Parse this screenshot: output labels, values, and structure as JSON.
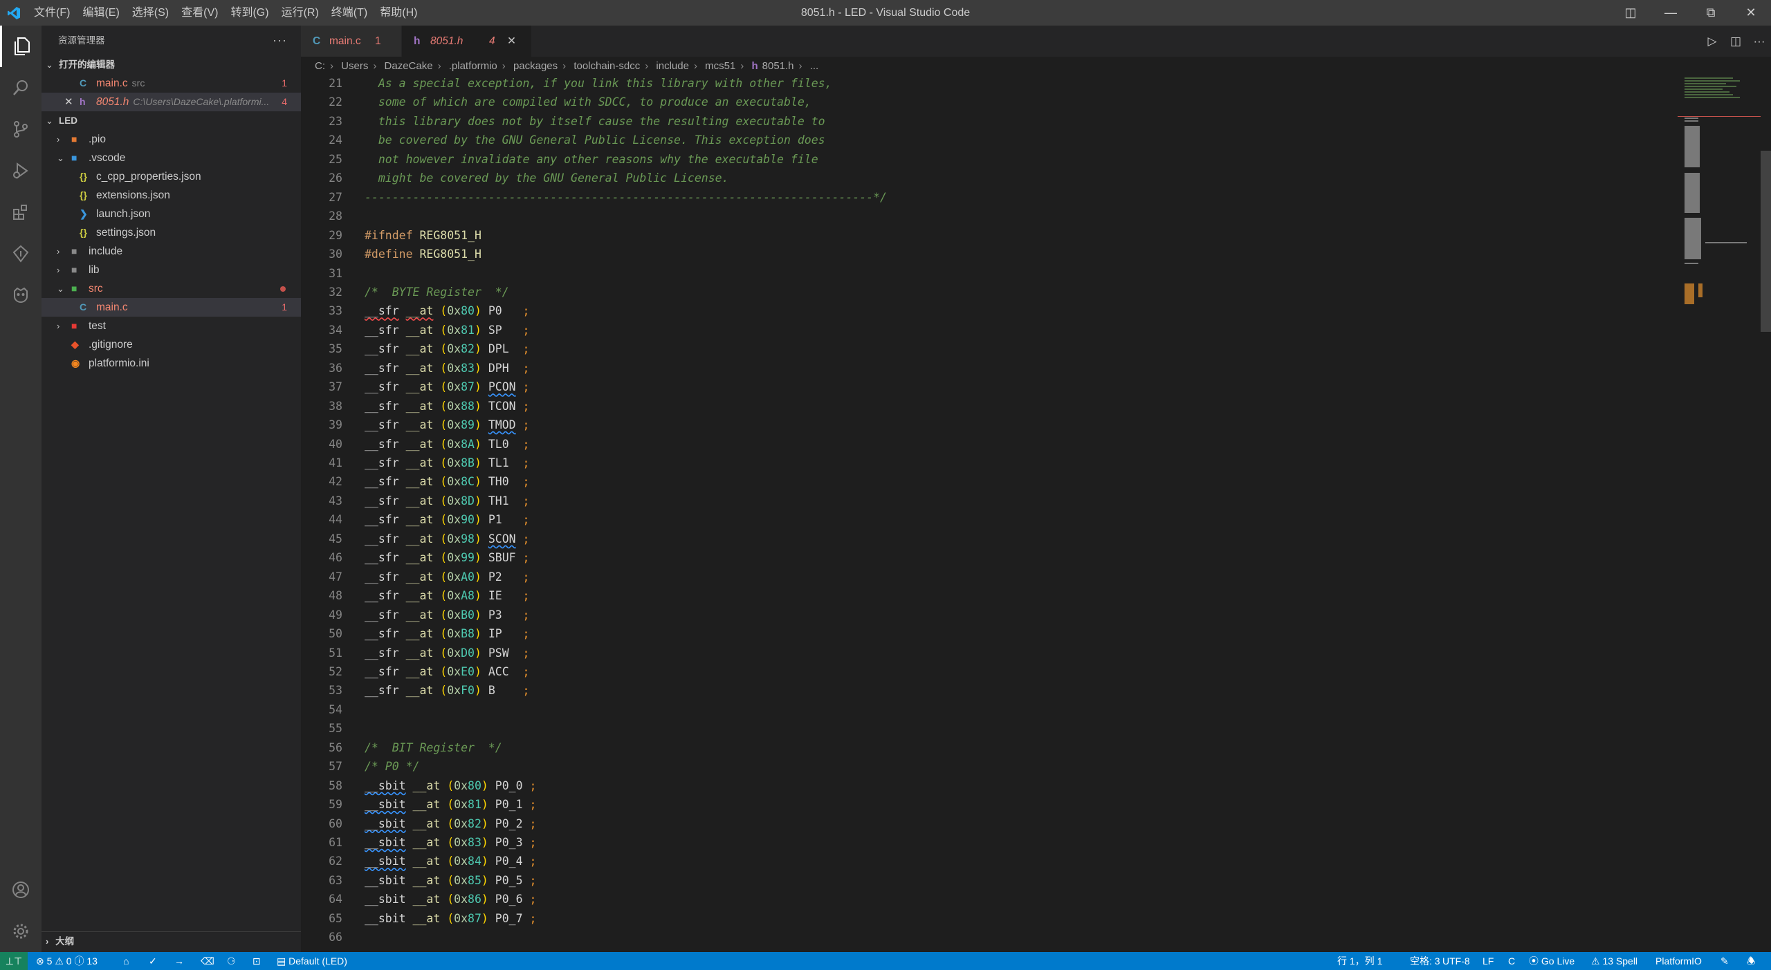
{
  "titlebar": {
    "menu": [
      "文件(F)",
      "编辑(E)",
      "选择(S)",
      "查看(V)",
      "转到(G)",
      "运行(R)",
      "终端(T)",
      "帮助(H)"
    ],
    "title": "8051.h - LED - Visual Studio Code"
  },
  "sidebar": {
    "header": "资源管理器",
    "open_editors": {
      "title": "打开的编辑器",
      "items": [
        {
          "name": "main.c",
          "desc": "src",
          "badge": "1"
        },
        {
          "name": "8051.h",
          "desc": "C:\\Users\\DazeCake\\.platformi...",
          "badge": "4"
        }
      ]
    },
    "project": {
      "title": "LED",
      "items": [
        {
          "name": ".pio"
        },
        {
          "name": ".vscode"
        },
        {
          "name": "c_cpp_properties.json"
        },
        {
          "name": "extensions.json"
        },
        {
          "name": "launch.json"
        },
        {
          "name": "settings.json"
        },
        {
          "name": "include"
        },
        {
          "name": "lib"
        },
        {
          "name": "src"
        },
        {
          "name": "main.c",
          "badge": "1"
        },
        {
          "name": "test"
        },
        {
          "name": ".gitignore"
        },
        {
          "name": "platformio.ini"
        }
      ]
    },
    "outline_title": "大纲"
  },
  "tabs": [
    {
      "label": "main.c",
      "badge": "1"
    },
    {
      "label": "8051.h",
      "badge": "4"
    }
  ],
  "breadcrumb": [
    "C:",
    "Users",
    "DazeCake",
    ".platformio",
    "packages",
    "toolchain-sdcc",
    "include",
    "mcs51",
    "8051.h",
    "..."
  ],
  "editor": {
    "comment_lines": [
      "  As a special exception, if you link this library with other files,",
      "  some of which are compiled with SDCC, to produce an executable,",
      "  this library does not by itself cause the resulting executable to",
      "  be covered by the GNU General Public License. This exception does",
      "  not however invalidate any other reasons why the executable file",
      "  might be covered by the GNU General Public License.",
      "--------------------------------------------------------------------------*/"
    ],
    "ifndef": {
      "kw": "#ifndef",
      "name": "REG8051_H"
    },
    "define": {
      "kw": "#define",
      "name": "REG8051_H"
    },
    "byte_comment": "/*  BYTE Register  */",
    "sfr_registers": [
      {
        "addr": "80",
        "name": "P0  "
      },
      {
        "addr": "81",
        "name": "SP  "
      },
      {
        "addr": "82",
        "name": "DPL "
      },
      {
        "addr": "83",
        "name": "DPH "
      },
      {
        "addr": "87",
        "name": "PCON"
      },
      {
        "addr": "88",
        "name": "TCON"
      },
      {
        "addr": "89",
        "name": "TMOD"
      },
      {
        "addr": "8A",
        "name": "TL0 "
      },
      {
        "addr": "8B",
        "name": "TL1 "
      },
      {
        "addr": "8C",
        "name": "TH0 "
      },
      {
        "addr": "8D",
        "name": "TH1 "
      },
      {
        "addr": "90",
        "name": "P1  "
      },
      {
        "addr": "98",
        "name": "SCON"
      },
      {
        "addr": "99",
        "name": "SBUF"
      },
      {
        "addr": "A0",
        "name": "P2  "
      },
      {
        "addr": "A8",
        "name": "IE  "
      },
      {
        "addr": "B0",
        "name": "P3  "
      },
      {
        "addr": "B8",
        "name": "IP  "
      },
      {
        "addr": "D0",
        "name": "PSW "
      },
      {
        "addr": "E0",
        "name": "ACC "
      },
      {
        "addr": "F0",
        "name": "B   "
      }
    ],
    "bit_comment": "/*  BIT Register  */",
    "p0_comment": "/* P0 */",
    "sbit_registers": [
      {
        "addr": "80",
        "name": "P0_0"
      },
      {
        "addr": "81",
        "name": "P0_1"
      },
      {
        "addr": "82",
        "name": "P0_2"
      },
      {
        "addr": "83",
        "name": "P0_3"
      },
      {
        "addr": "84",
        "name": "P0_4"
      },
      {
        "addr": "85",
        "name": "P0_5"
      },
      {
        "addr": "86",
        "name": "P0_6"
      },
      {
        "addr": "87",
        "name": "P0_7"
      }
    ],
    "first_line": 21,
    "last_line": 66
  },
  "statusbar": {
    "errors": "5",
    "warnings": "0",
    "infos": "13",
    "env": "Default (LED)",
    "position": "行 1，列 1",
    "spaces": "空格: 3",
    "encoding": "UTF-8",
    "eol": "LF",
    "language": "C",
    "golive": "Go Live",
    "spell": "13 Spell",
    "platformio": "PlatformIO"
  },
  "colors": {
    "accent": "#007acc",
    "error": "#f48771",
    "titlebar": "#3c3c3c"
  }
}
